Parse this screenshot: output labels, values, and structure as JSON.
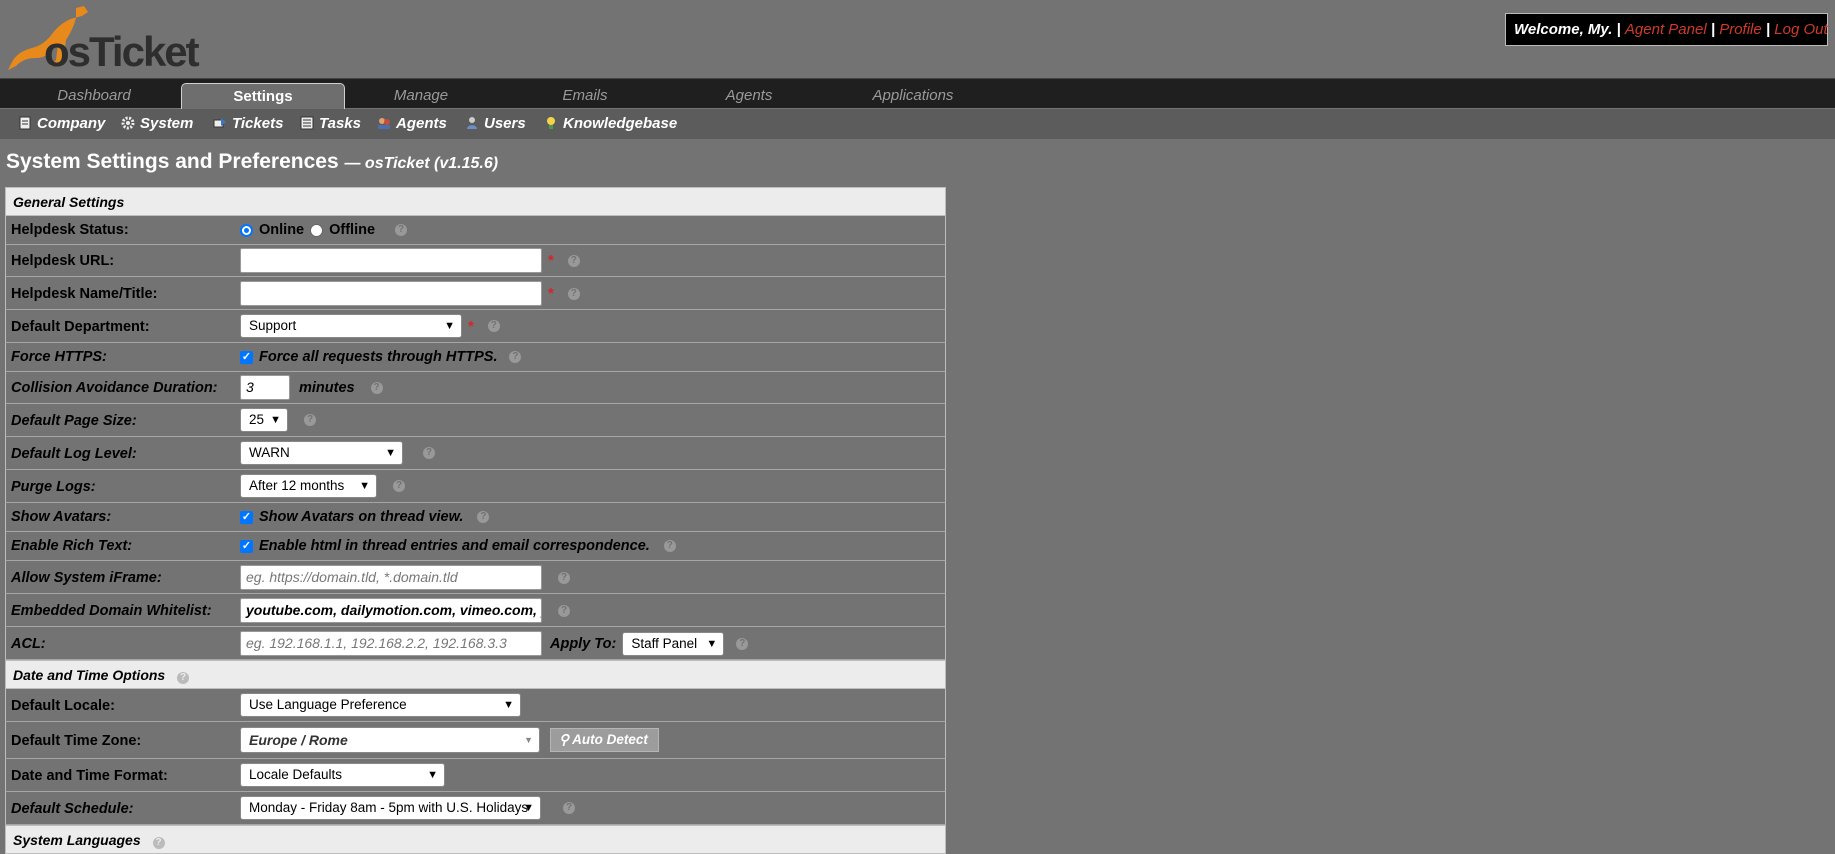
{
  "header": {
    "logo_text": "osTicket",
    "welcome": "Welcome, My.",
    "sep": "|",
    "agent_panel": "Agent Panel",
    "profile": "Profile",
    "logout": "Log Out"
  },
  "nav": {
    "tabs": [
      {
        "label": "Dashboard",
        "active": false
      },
      {
        "label": "Settings",
        "active": true
      },
      {
        "label": "Manage",
        "active": false
      },
      {
        "label": "Emails",
        "active": false
      },
      {
        "label": "Agents",
        "active": false
      },
      {
        "label": "Applications",
        "active": false
      }
    ]
  },
  "subnav": {
    "items": [
      {
        "label": "Company",
        "icon": "document-icon"
      },
      {
        "label": "System",
        "icon": "gear-icon"
      },
      {
        "label": "Tickets",
        "icon": "ticket-icon"
      },
      {
        "label": "Tasks",
        "icon": "list-icon"
      },
      {
        "label": "Agents",
        "icon": "agents-icon"
      },
      {
        "label": "Users",
        "icon": "user-icon"
      },
      {
        "label": "Knowledgebase",
        "icon": "lightbulb-icon"
      }
    ]
  },
  "page": {
    "title": "System Settings and Preferences",
    "subtitle": "— osTicket (v1.15.6)"
  },
  "sections": {
    "general": "General Settings",
    "datetime": "Date and Time Options",
    "languages": "System Languages"
  },
  "fields": {
    "helpdesk_status": {
      "label": "Helpdesk Status:",
      "online": "Online",
      "offline": "Offline",
      "value": "Online"
    },
    "helpdesk_url": {
      "label": "Helpdesk URL:",
      "value": ""
    },
    "helpdesk_name": {
      "label": "Helpdesk Name/Title:",
      "value": ""
    },
    "default_dept": {
      "label": "Default Department:",
      "value": "Support"
    },
    "force_https": {
      "label": "Force HTTPS:",
      "text": "Force all requests through HTTPS.",
      "checked": true
    },
    "collision": {
      "label": "Collision Avoidance Duration:",
      "value": "3",
      "unit": "minutes"
    },
    "page_size": {
      "label": "Default Page Size:",
      "value": "25"
    },
    "log_level": {
      "label": "Default Log Level:",
      "value": "WARN"
    },
    "purge_logs": {
      "label": "Purge Logs:",
      "value": "After 12 months"
    },
    "avatars": {
      "label": "Show Avatars:",
      "text": "Show Avatars on thread view.",
      "checked": true
    },
    "rich_text": {
      "label": "Enable Rich Text:",
      "text": "Enable html in thread entries and email correspondence.",
      "checked": true
    },
    "iframe": {
      "label": "Allow System iFrame:",
      "placeholder": "eg. https://domain.tld, *.domain.tld"
    },
    "whitelist": {
      "label": "Embedded Domain Whitelist:",
      "value": "youtube.com, dailymotion.com, vimeo.com, pla"
    },
    "acl": {
      "label": "ACL:",
      "placeholder": "eg. 192.168.1.1, 192.168.2.2, 192.168.3.3",
      "apply_label": "Apply To:",
      "apply_value": "Staff Panel"
    },
    "locale": {
      "label": "Default Locale:",
      "value": "Use Language Preference"
    },
    "timezone": {
      "label": "Default Time Zone:",
      "value": "Europe / Rome",
      "auto_detect": "Auto Detect"
    },
    "dt_format": {
      "label": "Date and Time Format:",
      "value": "Locale Defaults"
    },
    "schedule": {
      "label": "Default Schedule:",
      "value": "Monday - Friday 8am - 5pm with U.S. Holidays"
    }
  },
  "colors": {
    "page_bg": "#737373",
    "nav_bg": "#1f1f1f",
    "subnav_bg": "#5c5c5c",
    "link_red": "#d03a2a",
    "required_red": "#d8242b",
    "checkbox_blue": "#0075ff"
  }
}
